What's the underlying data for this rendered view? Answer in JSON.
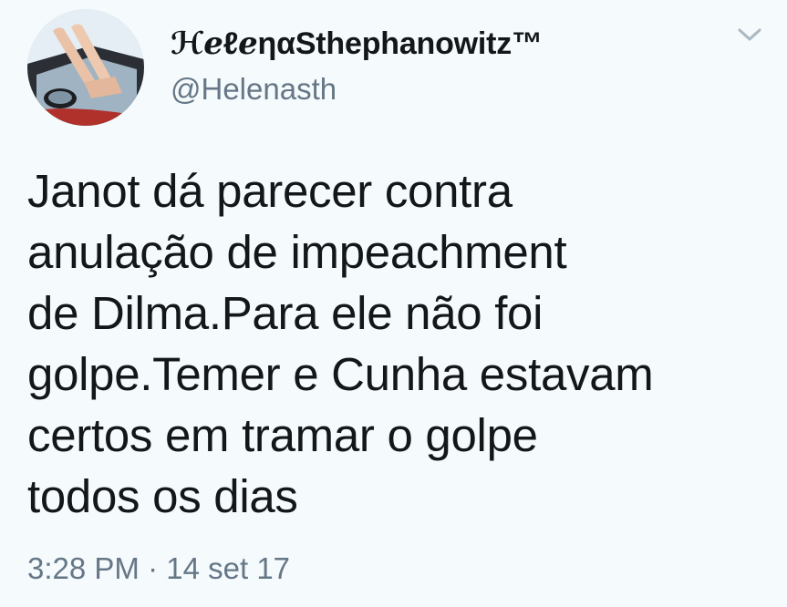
{
  "author": {
    "display_name": "ℋℯℓℯηαSthephanowitz™",
    "username": "@Helenasth"
  },
  "tweet": {
    "text": "Janot dá parecer contra\nanulação de impeachment\nde Dilma.Para ele não foi\ngolpe.Temer e Cunha estavam\ncertos em tramar o golpe\ntodos os dias",
    "time": "3:28 PM",
    "separator": "·",
    "date": "14 set 17"
  },
  "icons": {
    "menu": "chevron-down-icon",
    "avatar": "avatar-image"
  },
  "colors": {
    "background": "#f5fafc",
    "text": "#14171a",
    "secondary": "#657786",
    "chevron": "#aab8c2"
  }
}
